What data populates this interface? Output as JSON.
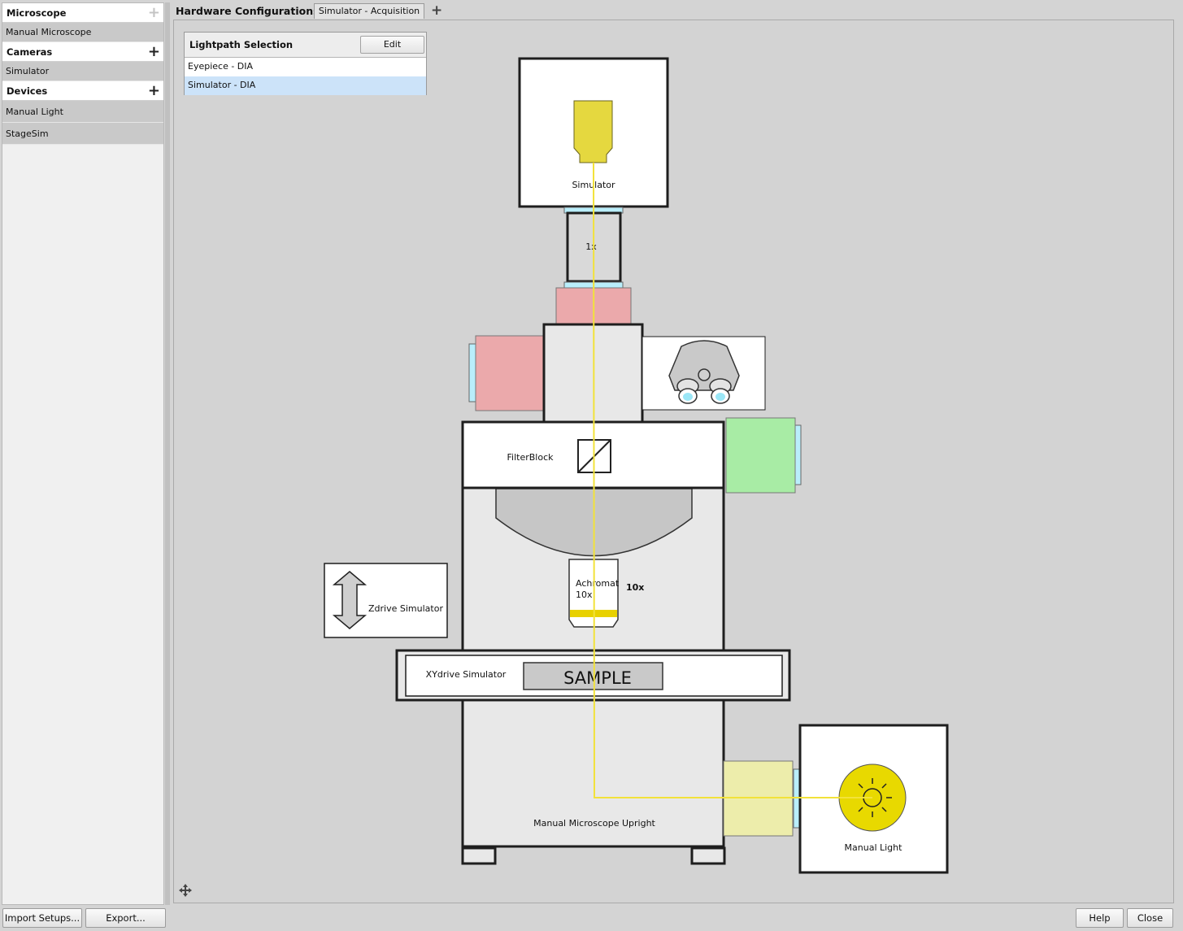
{
  "sidebar": {
    "sections": [
      {
        "title": "Microscope",
        "add_enabled": false,
        "items": [
          "Manual Microscope"
        ]
      },
      {
        "title": "Cameras",
        "add_enabled": true,
        "items": [
          "Simulator"
        ]
      },
      {
        "title": "Devices",
        "add_enabled": true,
        "items": [
          "Manual Light",
          "StageSim"
        ]
      }
    ]
  },
  "header": {
    "label": "Hardware Configurations:",
    "tabs": [
      "Simulator - Acquisition"
    ],
    "add_icon": "plus-icon"
  },
  "lightpath": {
    "title": "Lightpath Selection",
    "edit_label": "Edit",
    "options": [
      "Eyepiece - DIA",
      "Simulator - DIA"
    ],
    "selected": "Simulator - DIA"
  },
  "diagram": {
    "camera_label": "Simulator",
    "magnifier_label": "1x",
    "filterblock_label": "FilterBlock",
    "objective_name": "Achromat",
    "objective_mag": "10x",
    "objective_mag_bold": "10x",
    "zdrive_label": "Zdrive Simulator",
    "xydrive_label": "XYdrive Simulator",
    "sample_label": "SAMPLE",
    "body_label": "Manual Microscope Upright",
    "light_label": "Manual Light"
  },
  "colors": {
    "light_path": "#f2e23a",
    "camera": "#e5d83f",
    "red_port": "#eba9ab",
    "green_port": "#a8eca5",
    "yellow_filter": "#ededab",
    "selected_row": "#cce3f9",
    "adapter": "#b9eefb"
  },
  "footer": {
    "import_label": "Import Setups...",
    "export_label": "Export...",
    "help_label": "Help",
    "close_label": "Close"
  }
}
